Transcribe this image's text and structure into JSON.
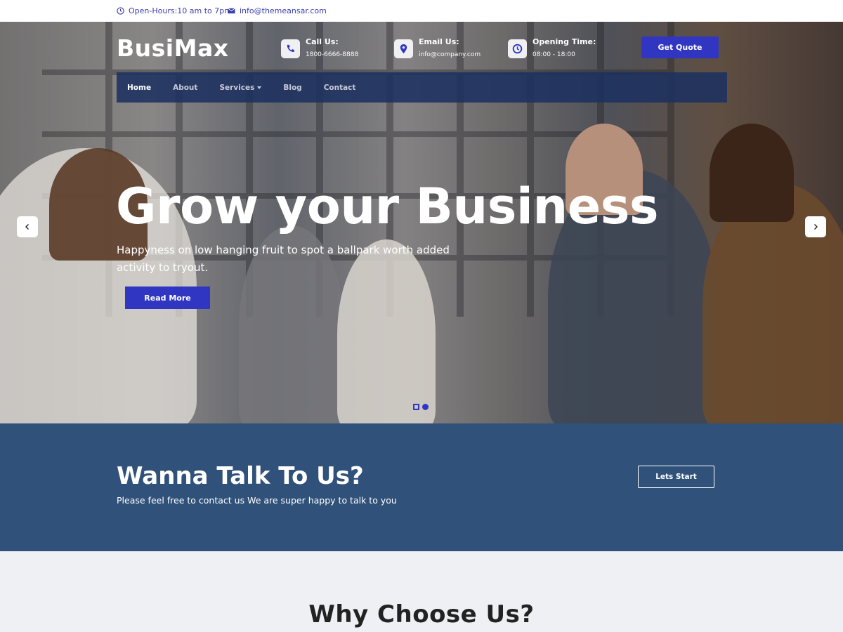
{
  "topbar": {
    "hours": "Open-Hours:10 am to 7pm",
    "email": "info@themeansar.com"
  },
  "header": {
    "logo": "BusiMax",
    "contacts": [
      {
        "title": "Call Us:",
        "value": "1800-6666-8888",
        "icon": "phone-icon"
      },
      {
        "title": "Email Us:",
        "value": "info@company.com",
        "icon": "location-pin-icon"
      },
      {
        "title": "Opening Time:",
        "value": "08:00 - 18:00",
        "icon": "clock-icon"
      }
    ],
    "quote_button": "Get Quote"
  },
  "nav": {
    "items": [
      {
        "label": "Home",
        "active": true
      },
      {
        "label": "About"
      },
      {
        "label": "Services",
        "dropdown": true
      },
      {
        "label": "Blog"
      },
      {
        "label": "Contact"
      }
    ]
  },
  "hero": {
    "title": "Grow your Business",
    "subtitle": "Happyness on low hanging fruit to spot a ballpark worth added activity to tryout.",
    "button": "Read More",
    "slides": 2,
    "active_slide": 1
  },
  "cta": {
    "title": "Wanna Talk To Us?",
    "subtitle": "Please feel free to contact us We are super happy to talk to you",
    "button": "Lets Start"
  },
  "why": {
    "title": "Why Choose Us?"
  },
  "colors": {
    "accent": "#3036c1",
    "nav_bg": "#1c3160",
    "cta_bg": "#30527a",
    "section_bg": "#eef0f4"
  }
}
